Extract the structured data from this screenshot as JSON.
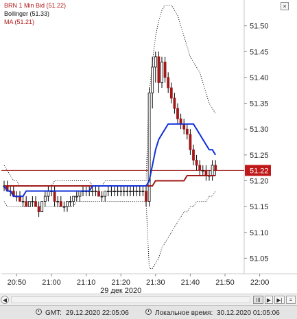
{
  "legend": {
    "instrument": "BRN 1 Min Bid (51.22)",
    "bollinger": "Bollinger (51.33)",
    "ma": "MA (51.21)"
  },
  "colors": {
    "price": "#a01818",
    "ma": "#a01818",
    "bollinger_mid": "#1030d8",
    "bands": "#000000",
    "current_price_bg": "#c01818",
    "background": "#ffffff"
  },
  "close_label": "×",
  "chart_data": {
    "type": "candlestick",
    "instrument": "BRN 1 Min Bid",
    "x_ticks": [
      "20:50",
      "21:00",
      "21:10",
      "21:20",
      "21:30",
      "21:40",
      "21:50",
      "22:00"
    ],
    "date_label": "29 дек 2020",
    "y_ticks": [
      51.05,
      51.1,
      51.15,
      51.2,
      51.25,
      51.3,
      51.35,
      51.4,
      51.45,
      51.5
    ],
    "ylim": [
      51.02,
      51.55
    ],
    "current_price": "51.22",
    "series": [
      {
        "name": "Bollinger",
        "values": [
          51.19,
          51.18,
          51.18,
          51.17,
          51.17,
          51.17,
          51.17,
          51.18,
          51.18,
          51.18,
          51.18,
          51.18,
          51.18,
          51.18,
          51.18,
          51.18,
          51.18,
          51.18,
          51.18,
          51.18,
          51.18,
          51.18,
          51.18,
          51.18,
          51.18,
          51.18,
          51.18,
          51.18,
          51.19,
          51.19,
          51.19,
          51.19,
          51.19,
          51.19,
          51.19,
          51.19,
          51.19,
          51.19,
          51.19,
          51.19,
          51.19,
          51.19,
          51.19,
          51.19,
          51.19,
          51.19,
          51.2,
          51.23,
          51.26,
          51.28,
          51.29,
          51.3,
          51.31,
          51.31,
          51.31,
          51.31,
          51.31,
          51.31,
          51.31,
          51.31,
          51.31,
          51.3,
          51.29,
          51.28,
          51.27,
          51.26,
          51.26,
          51.25
        ]
      },
      {
        "name": "MA",
        "values": [
          51.19,
          51.19,
          51.19,
          51.19,
          51.19,
          51.19,
          51.19,
          51.19,
          51.19,
          51.19,
          51.19,
          51.19,
          51.19,
          51.19,
          51.19,
          51.19,
          51.19,
          51.19,
          51.19,
          51.19,
          51.19,
          51.19,
          51.19,
          51.19,
          51.19,
          51.19,
          51.19,
          51.19,
          51.19,
          51.19,
          51.19,
          51.19,
          51.19,
          51.19,
          51.19,
          51.19,
          51.19,
          51.19,
          51.19,
          51.19,
          51.19,
          51.19,
          51.19,
          51.19,
          51.19,
          51.19,
          51.19,
          51.19,
          51.2,
          51.2,
          51.2,
          51.2,
          51.2,
          51.2,
          51.2,
          51.2,
          51.2,
          51.2,
          51.21,
          51.21,
          51.21,
          51.21,
          51.21,
          51.21,
          51.21,
          51.21,
          51.21,
          51.21
        ]
      },
      {
        "name": "Bollinger upper",
        "values": [
          51.23,
          51.22,
          51.21,
          51.2,
          51.2,
          51.19,
          51.19,
          51.19,
          51.19,
          51.19,
          51.19,
          51.19,
          51.19,
          51.19,
          51.19,
          51.19,
          51.2,
          51.2,
          51.2,
          51.2,
          51.2,
          51.2,
          51.2,
          51.2,
          51.2,
          51.2,
          51.2,
          51.2,
          51.19,
          51.19,
          51.19,
          51.19,
          51.2,
          51.2,
          51.2,
          51.2,
          51.2,
          51.2,
          51.2,
          51.2,
          51.2,
          51.2,
          51.2,
          51.2,
          51.2,
          51.2,
          51.37,
          51.43,
          51.48,
          51.51,
          51.53,
          51.54,
          51.54,
          51.54,
          51.53,
          51.52,
          51.5,
          51.48,
          51.46,
          51.44,
          51.43,
          51.42,
          51.41,
          51.39,
          51.37,
          51.35,
          51.34,
          51.33
        ]
      },
      {
        "name": "Bollinger lower",
        "values": [
          51.16,
          51.15,
          51.15,
          51.15,
          51.15,
          51.15,
          51.15,
          51.15,
          51.15,
          51.15,
          51.15,
          51.15,
          51.15,
          51.15,
          51.15,
          51.15,
          51.15,
          51.15,
          51.15,
          51.15,
          51.15,
          51.15,
          51.15,
          51.16,
          51.16,
          51.16,
          51.16,
          51.16,
          51.16,
          51.16,
          51.16,
          51.16,
          51.16,
          51.16,
          51.16,
          51.16,
          51.16,
          51.16,
          51.16,
          51.16,
          51.16,
          51.16,
          51.16,
          51.16,
          51.16,
          51.16,
          51.03,
          51.03,
          51.04,
          51.05,
          51.07,
          51.08,
          51.09,
          51.1,
          51.11,
          51.12,
          51.13,
          51.14,
          51.14,
          51.15,
          51.15,
          51.16,
          51.16,
          51.16,
          51.16,
          51.17,
          51.17,
          51.18
        ]
      }
    ],
    "candles": [
      [
        51.19,
        51.2,
        51.18,
        51.19
      ],
      [
        51.19,
        51.2,
        51.18,
        51.18
      ],
      [
        51.18,
        51.19,
        51.17,
        51.18
      ],
      [
        51.18,
        51.19,
        51.17,
        51.17
      ],
      [
        51.17,
        51.18,
        51.16,
        51.17
      ],
      [
        51.17,
        51.18,
        51.16,
        51.16
      ],
      [
        51.16,
        51.17,
        51.15,
        51.16
      ],
      [
        51.16,
        51.17,
        51.15,
        51.15
      ],
      [
        51.15,
        51.16,
        51.15,
        51.16
      ],
      [
        51.16,
        51.17,
        51.15,
        51.16
      ],
      [
        51.16,
        51.17,
        51.15,
        51.15
      ],
      [
        51.15,
        51.16,
        51.13,
        51.14
      ],
      [
        51.14,
        51.16,
        51.14,
        51.16
      ],
      [
        51.16,
        51.18,
        51.15,
        51.17
      ],
      [
        51.17,
        51.19,
        51.16,
        51.18
      ],
      [
        51.18,
        51.19,
        51.17,
        51.18
      ],
      [
        51.18,
        51.19,
        51.15,
        51.16
      ],
      [
        51.16,
        51.17,
        51.15,
        51.16
      ],
      [
        51.16,
        51.17,
        51.15,
        51.15
      ],
      [
        51.15,
        51.16,
        51.14,
        51.15
      ],
      [
        51.15,
        51.16,
        51.14,
        51.16
      ],
      [
        51.16,
        51.17,
        51.15,
        51.16
      ],
      [
        51.16,
        51.17,
        51.15,
        51.17
      ],
      [
        51.17,
        51.18,
        51.16,
        51.17
      ],
      [
        51.17,
        51.18,
        51.16,
        51.18
      ],
      [
        51.18,
        51.19,
        51.17,
        51.18
      ],
      [
        51.18,
        51.19,
        51.17,
        51.18
      ],
      [
        51.18,
        51.19,
        51.17,
        51.18
      ],
      [
        51.18,
        51.19,
        51.17,
        51.18
      ],
      [
        51.18,
        51.19,
        51.17,
        51.18
      ],
      [
        51.18,
        51.19,
        51.17,
        51.17
      ],
      [
        51.17,
        51.18,
        51.16,
        51.17
      ],
      [
        51.17,
        51.18,
        51.16,
        51.18
      ],
      [
        51.18,
        51.19,
        51.17,
        51.18
      ],
      [
        51.18,
        51.19,
        51.17,
        51.18
      ],
      [
        51.18,
        51.19,
        51.17,
        51.18
      ],
      [
        51.18,
        51.19,
        51.17,
        51.18
      ],
      [
        51.18,
        51.19,
        51.17,
        51.18
      ],
      [
        51.18,
        51.19,
        51.17,
        51.18
      ],
      [
        51.18,
        51.19,
        51.17,
        51.18
      ],
      [
        51.18,
        51.19,
        51.17,
        51.18
      ],
      [
        51.18,
        51.19,
        51.17,
        51.18
      ],
      [
        51.18,
        51.19,
        51.17,
        51.18
      ],
      [
        51.18,
        51.19,
        51.17,
        51.18
      ],
      [
        51.18,
        51.19,
        51.17,
        51.18
      ],
      [
        51.18,
        51.19,
        51.15,
        51.16
      ],
      [
        51.16,
        51.38,
        51.15,
        51.37
      ],
      [
        51.37,
        51.44,
        51.34,
        51.42
      ],
      [
        51.42,
        51.45,
        51.39,
        51.44
      ],
      [
        51.44,
        51.45,
        51.37,
        51.39
      ],
      [
        51.39,
        51.44,
        51.38,
        51.43
      ],
      [
        51.43,
        51.44,
        51.39,
        51.4
      ],
      [
        51.4,
        51.41,
        51.37,
        51.38
      ],
      [
        51.38,
        51.39,
        51.35,
        51.36
      ],
      [
        51.36,
        51.37,
        51.33,
        51.34
      ],
      [
        51.34,
        51.35,
        51.31,
        51.32
      ],
      [
        51.32,
        51.33,
        51.3,
        51.31
      ],
      [
        51.31,
        51.32,
        51.29,
        51.3
      ],
      [
        51.3,
        51.31,
        51.28,
        51.29
      ],
      [
        51.29,
        51.3,
        51.25,
        51.26
      ],
      [
        51.26,
        51.27,
        51.23,
        51.24
      ],
      [
        51.24,
        51.25,
        51.22,
        51.23
      ],
      [
        51.23,
        51.24,
        51.21,
        51.22
      ],
      [
        51.22,
        51.23,
        51.21,
        51.22
      ],
      [
        51.22,
        51.23,
        51.2,
        51.21
      ],
      [
        51.21,
        51.22,
        51.2,
        51.21
      ],
      [
        51.21,
        51.24,
        51.2,
        51.23
      ],
      [
        51.23,
        51.24,
        51.21,
        51.22
      ]
    ]
  },
  "scrollbar": {
    "left_btn": "◀",
    "right_btn": "▶",
    "extra_btn": "▶|"
  },
  "status": {
    "gmt_label": "GMT:",
    "gmt_value": "29.12.2020 22:05:06",
    "local_label": "Локальное время:",
    "local_value": "30.12.2020 01:05:06"
  }
}
